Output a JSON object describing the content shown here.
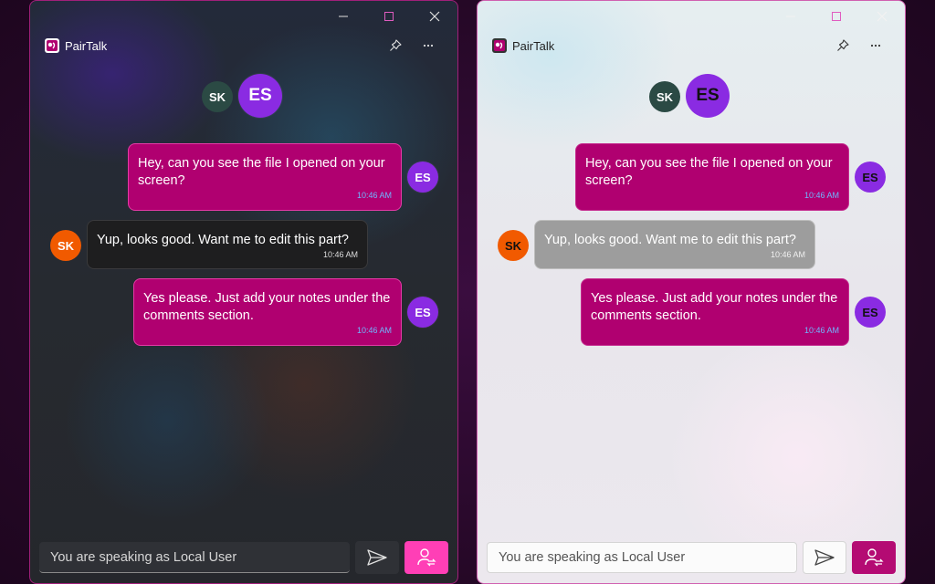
{
  "app": {
    "name": "PairTalk"
  },
  "colors": {
    "brand_magenta": "#b00070",
    "avatar_es": "#8a2be2",
    "avatar_sk": "#f15a00",
    "avatar_sk_header": "#2b4a44",
    "switch_button_dark": "#ff3fb6",
    "switch_button_light": "#b40b73"
  },
  "participants": [
    {
      "initials": "SK"
    },
    {
      "initials": "ES"
    }
  ],
  "messages": [
    {
      "sender": "ES",
      "direction": "outgoing",
      "text": "Hey, can you see the file I opened on your screen?",
      "line1": "Hey, can you see the file I opened on your",
      "line2": "screen?",
      "time": "10:46 AM"
    },
    {
      "sender": "SK",
      "direction": "incoming",
      "text": "Yup, looks good. Want me to edit this part?",
      "time": "10:46 AM"
    },
    {
      "sender": "ES",
      "direction": "outgoing",
      "text": "Yes please. Just add your notes under the comments section.",
      "line1": "Yes please. Just add your notes under the",
      "line2": "comments section.",
      "time": "10:46 AM"
    }
  ],
  "composer": {
    "placeholder": "You are speaking as Local User"
  },
  "icons": {
    "minimize": "minimize-icon",
    "maximize": "maximize-icon",
    "close": "close-icon",
    "pin": "pin-icon",
    "more": "more-icon",
    "send": "send-icon",
    "switch_user": "switch-user-icon"
  }
}
